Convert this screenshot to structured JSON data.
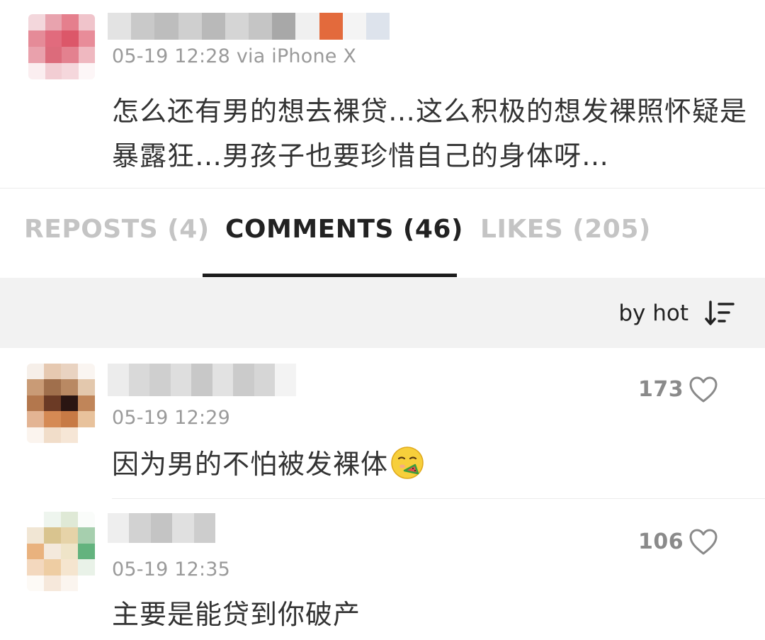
{
  "post": {
    "timestamp": "05-19 12:28 via iPhone X",
    "text": "怎么还有男的想去裸贷…这么积极的想发裸照怀疑是暴露狂…男孩子也要珍惜自己的身体呀…"
  },
  "tabs": [
    {
      "label": "REPOSTS (4)",
      "active": false
    },
    {
      "label": "COMMENTS (46)",
      "active": true
    },
    {
      "label": "LIKES (205)",
      "active": false
    }
  ],
  "sort": {
    "label": "by hot",
    "icon": "sort-descending-icon"
  },
  "comments": [
    {
      "timestamp": "05-19 12:29",
      "text": "因为男的不怕被发裸体",
      "emoji": "eating-watermelon-emoji",
      "likes": "173",
      "like_icon": "heart-outline-icon"
    },
    {
      "timestamp": "05-19 12:35",
      "text": "主要是能贷到你破产",
      "likes": "106",
      "like_icon": "heart-outline-icon"
    }
  ],
  "colors": {
    "text_primary": "#333333",
    "text_meta": "#9a9a9a",
    "tab_active": "#222222",
    "tab_inactive": "#c4c4c4",
    "sort_bar_bg": "#f2f2f2"
  }
}
